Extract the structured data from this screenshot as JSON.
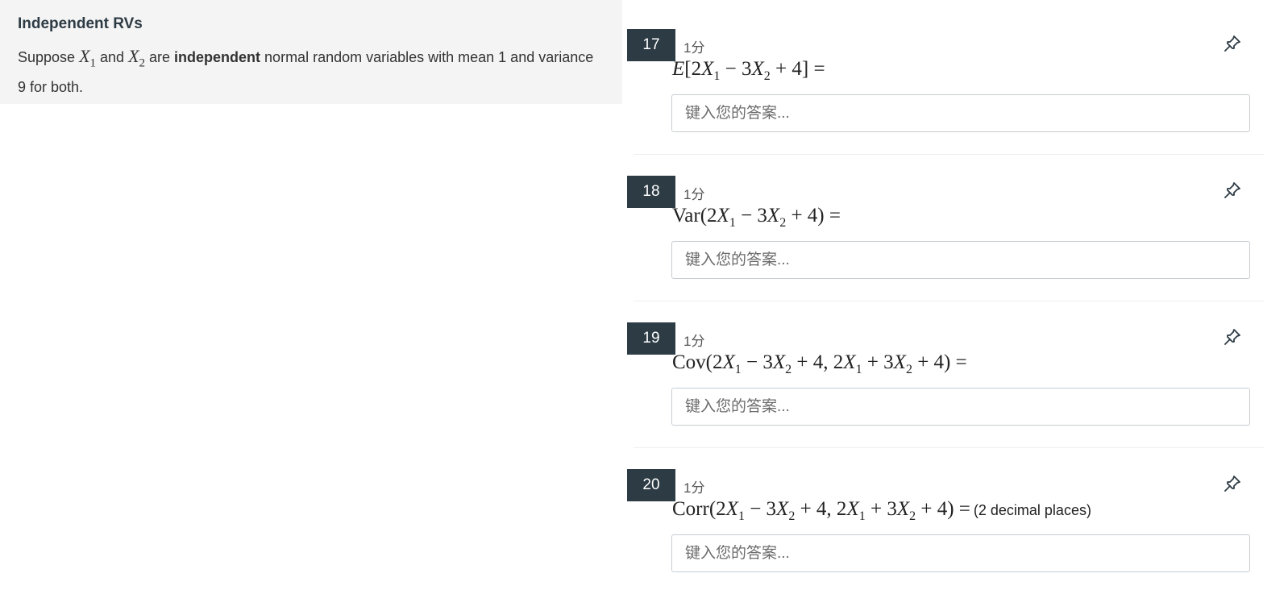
{
  "context": {
    "title": "Independent RVs",
    "text_prefix": "Suppose ",
    "x1": "X",
    "x1_sub": "1",
    "and": " and ",
    "x2": "X",
    "x2_sub": "2",
    "are": " are ",
    "emphasis": "independent",
    "text_suffix": " normal random variables with mean 1 and variance 9 for both."
  },
  "questions": [
    {
      "number": "17",
      "points": "1分",
      "placeholder": "键入您的答案...",
      "answer": ""
    },
    {
      "number": "18",
      "points": "1分",
      "placeholder": "键入您的答案...",
      "answer": ""
    },
    {
      "number": "19",
      "points": "1分",
      "placeholder": "键入您的答案...",
      "answer": ""
    },
    {
      "number": "20",
      "points": "1分",
      "placeholder": "键入您的答案...",
      "answer": "",
      "note": "(2 decimal places)"
    }
  ],
  "icons": {
    "pin": "pin-icon"
  },
  "colors": {
    "badge_bg": "#2d3b45",
    "badge_text": "#ffffff",
    "context_bg": "#f4f4f4"
  }
}
